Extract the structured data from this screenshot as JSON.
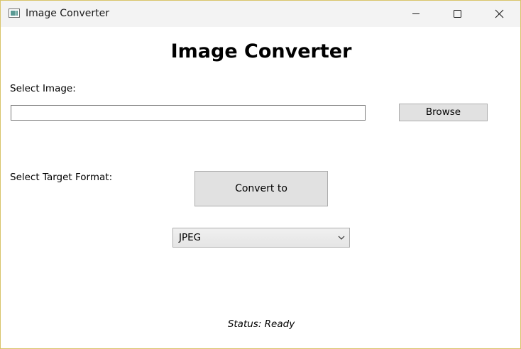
{
  "window": {
    "title": "Image Converter",
    "icon": "app-window-icon",
    "controls": {
      "minimize_icon": "minimize-icon",
      "maximize_icon": "maximize-icon",
      "close_icon": "close-icon"
    }
  },
  "main": {
    "heading": "Image Converter",
    "select_image_label": "Select Image:",
    "image_path": {
      "value": "",
      "placeholder": ""
    },
    "browse_label": "Browse",
    "select_format_label": "Select Target Format:",
    "convert_label": "Convert to",
    "format_select": {
      "selected": "JPEG",
      "icon": "chevron-down-icon"
    },
    "status_text": "Status: Ready"
  },
  "colors": {
    "titlebar_bg": "#f3f3f3",
    "window_border": "#d8c46a",
    "button_bg": "#e1e1e1",
    "button_border": "#adadad"
  }
}
